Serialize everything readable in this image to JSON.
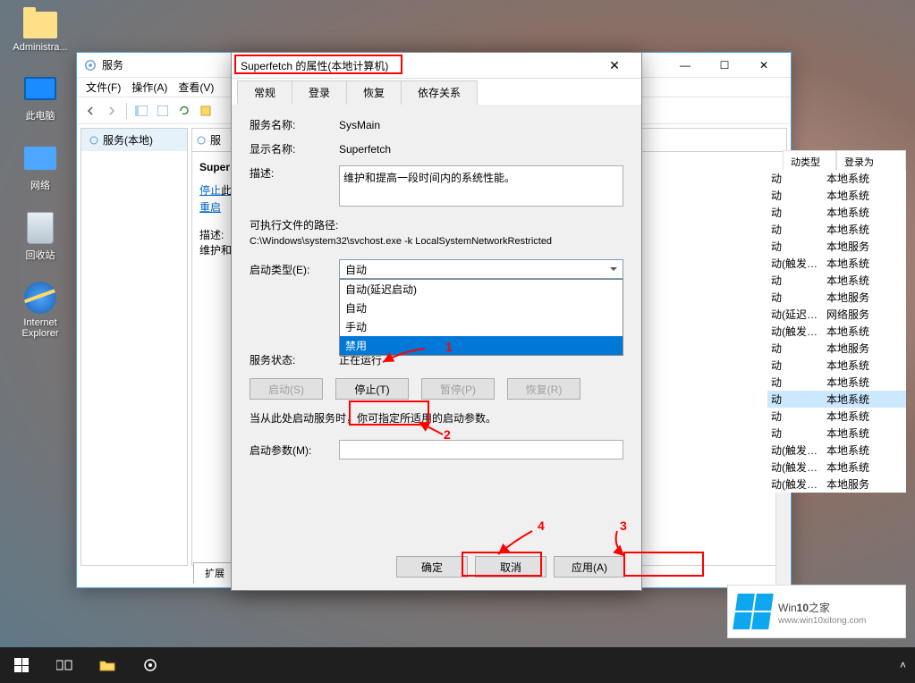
{
  "desktop": {
    "icons": [
      {
        "name": "administrator",
        "label": "Administra..."
      },
      {
        "name": "this-pc",
        "label": "此电脑"
      },
      {
        "name": "network",
        "label": "网络"
      },
      {
        "name": "recycle-bin",
        "label": "回收站"
      },
      {
        "name": "ie",
        "label": "Internet Explorer"
      }
    ]
  },
  "services_window": {
    "title": "服务",
    "menubar": [
      "文件(F)",
      "操作(A)",
      "查看(V)"
    ],
    "left_item": "服务(本地)",
    "main_header": "服",
    "detail_title": "Super",
    "link_stop": "停止",
    "link_restart": "重启",
    "link_stop_suffix": "此",
    "link_restart_suffix": "",
    "desc_label": "描述:",
    "desc_text": "维护和",
    "tabs": [
      "扩展"
    ],
    "columns": [
      "动类型",
      "登录为"
    ],
    "rows": [
      {
        "c1": "动",
        "c2": "本地系统"
      },
      {
        "c1": "动",
        "c2": "本地系统"
      },
      {
        "c1": "动",
        "c2": "本地系统"
      },
      {
        "c1": "动",
        "c2": "本地系统"
      },
      {
        "c1": "动",
        "c2": "本地服务"
      },
      {
        "c1": "动(触发…",
        "c2": "本地系统"
      },
      {
        "c1": "动",
        "c2": "本地系统"
      },
      {
        "c1": "动",
        "c2": "本地服务"
      },
      {
        "c1": "动(延迟…",
        "c2": "网络服务"
      },
      {
        "c1": "动(触发…",
        "c2": "本地系统"
      },
      {
        "c1": "动",
        "c2": "本地服务"
      },
      {
        "c1": "动",
        "c2": "本地系统"
      },
      {
        "c1": "动",
        "c2": "本地系统"
      },
      {
        "c1": "动",
        "c2": "本地系统"
      },
      {
        "c1": "动",
        "c2": "本地系统"
      },
      {
        "c1": "动",
        "c2": "本地系统"
      },
      {
        "c1": "动(触发…",
        "c2": "本地系统"
      },
      {
        "c1": "动(触发…",
        "c2": "本地系统"
      },
      {
        "c1": "动(触发…",
        "c2": "本地服务"
      }
    ]
  },
  "props": {
    "title": "Superfetch 的属性(本地计算机)",
    "tabs": [
      "常规",
      "登录",
      "恢复",
      "依存关系"
    ],
    "service_name_label": "服务名称:",
    "service_name": "SysMain",
    "display_name_label": "显示名称:",
    "display_name": "Superfetch",
    "desc_label": "描述:",
    "desc": "维护和提高一段时间内的系统性能。",
    "exe_label": "可执行文件的路径:",
    "exe_path": "C:\\Windows\\system32\\svchost.exe -k LocalSystemNetworkRestricted",
    "startup_label": "启动类型(E):",
    "startup_value": "自动",
    "startup_options": [
      "自动(延迟启动)",
      "自动",
      "手动",
      "禁用"
    ],
    "status_label": "服务状态:",
    "status": "正在运行",
    "btn_start": "启动(S)",
    "btn_stop": "停止(T)",
    "btn_pause": "暂停(P)",
    "btn_resume": "恢复(R)",
    "hint": "当从此处启动服务时，你可指定所适用的启动参数。",
    "param_label": "启动参数(M):",
    "ok": "确定",
    "cancel": "取消",
    "apply": "应用(A)"
  },
  "annotations": {
    "a1": "1",
    "a2": "2",
    "a3": "3",
    "a4": "4"
  },
  "watermark": {
    "title_1": "Win",
    "title_2": "10",
    "title_3": "之家",
    "url": "www.win10xitong.com"
  },
  "close_x": "✕",
  "min_sym": "—",
  "max_sym": "☐"
}
